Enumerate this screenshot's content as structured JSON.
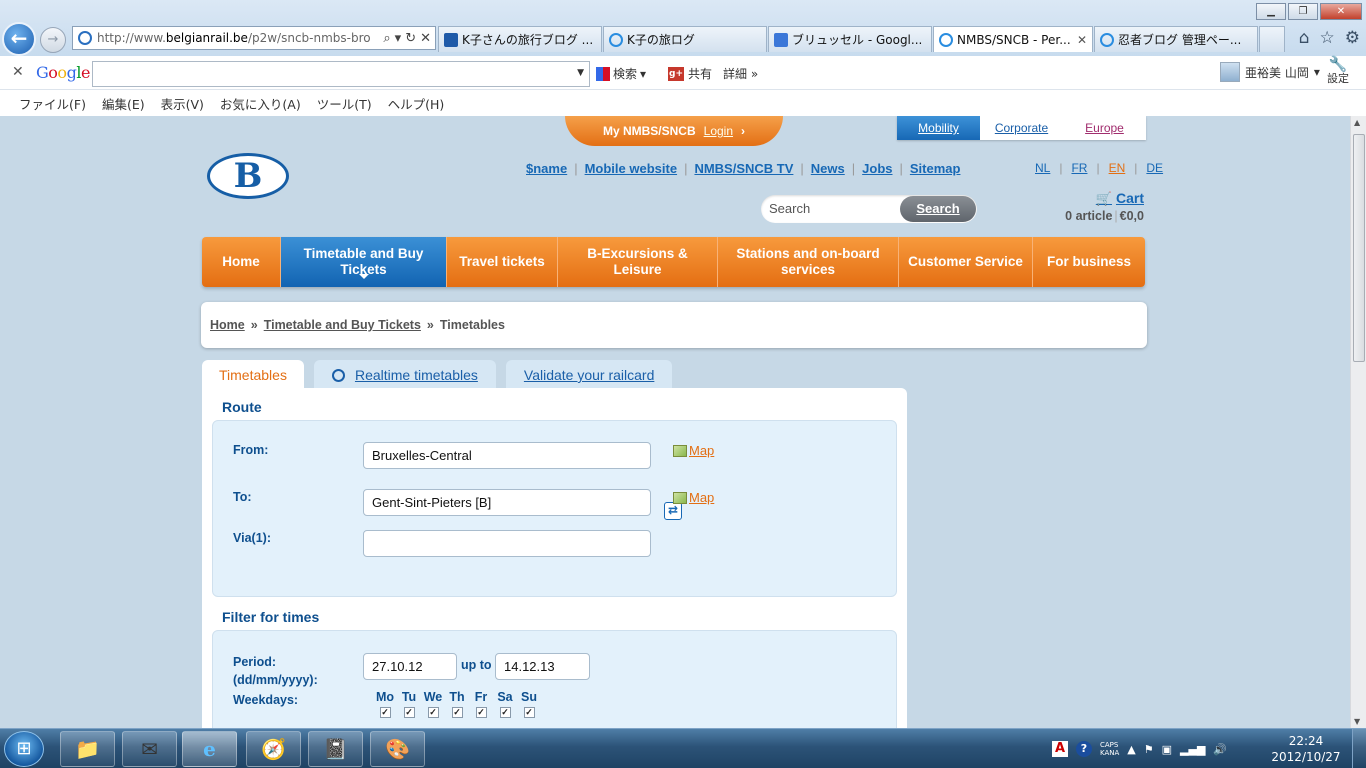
{
  "browser": {
    "address_prefix": "http://www.",
    "address_host": "belgianrail.be",
    "address_path": "/p2w/sncb-nmbs-bro",
    "tabs": [
      {
        "label": "K子さんの旅行ブログ ...",
        "icon_color": "#1f5aa8"
      },
      {
        "label": "K子の旅ログ",
        "icon_color": "#2a8de0"
      },
      {
        "label": "ブリュッセル - Googl...",
        "icon_color": "#3b77d8"
      },
      {
        "label": "NMBS/SNCB - Per...",
        "icon_color": "#2a8de0"
      },
      {
        "label": "忍者ブログ 管理ペー...",
        "icon_color": "#2a8de0"
      }
    ],
    "window_controls": [
      "▁",
      "❐",
      "✕"
    ]
  },
  "google_toolbar": {
    "logo": "Google",
    "search_label": "検索",
    "share_label": "共有",
    "more_label": "詳細",
    "user_name": "亜裕美 山岡",
    "settings_label": "設定"
  },
  "menubar": [
    "ファイル(F)",
    "編集(E)",
    "表示(V)",
    "お気に入り(A)",
    "ツール(T)",
    "ヘルプ(H)"
  ],
  "site": {
    "my_account_label": "My NMBS/SNCB",
    "login_label": "Login",
    "segment_tabs": [
      "Mobility",
      "Corporate",
      "Europe"
    ],
    "logo_letter": "B",
    "top_links": [
      "$name",
      "Mobile website",
      "NMBS/SNCB TV",
      "News",
      "Jobs",
      "Sitemap"
    ],
    "languages": [
      "NL",
      "FR",
      "EN",
      "DE"
    ],
    "active_language": "EN",
    "search_placeholder": "Search",
    "search_button": "Search",
    "cart_label": "Cart",
    "cart_articles": "0 article",
    "cart_total": "€0,0",
    "nav": [
      "Home",
      "Timetable and Buy Tickets",
      "Travel tickets",
      "B-Excursions & Leisure",
      "Stations and on-board services",
      "Customer Service",
      "For business"
    ],
    "active_nav": "Timetable and Buy Tickets",
    "breadcrumb": [
      "Home",
      "Timetable and Buy Tickets",
      "Timetables"
    ],
    "page_tabs": [
      "Timetables",
      "Realtime timetables",
      "Validate your railcard"
    ]
  },
  "form": {
    "route_title": "Route",
    "from_label": "From:",
    "from_value": "Bruxelles-Central",
    "to_label": "To:",
    "to_value": "Gent-Sint-Pieters [B]",
    "via_label": "Via(1):",
    "via_value": "",
    "map_label": "Map",
    "filter_title": "Filter for times",
    "period_label": "Period:",
    "period_format": "(dd/mm/yyyy):",
    "period_from": "27.10.12",
    "up_to_label": "up to",
    "period_to": "14.12.13",
    "weekdays_label": "Weekdays:",
    "weekdays": [
      "Mo",
      "Tu",
      "We",
      "Th",
      "Fr",
      "Sa",
      "Su"
    ],
    "weekdays_checked": [
      true,
      true,
      true,
      true,
      true,
      true,
      true
    ]
  },
  "taskbar": {
    "caps": "CAPS",
    "kana": "KANA",
    "time": "22:24",
    "date": "2012/10/27"
  },
  "colors": {
    "accent_orange": "#e36f14",
    "accent_blue": "#1768b5",
    "page_background": "#c6d8e6"
  }
}
